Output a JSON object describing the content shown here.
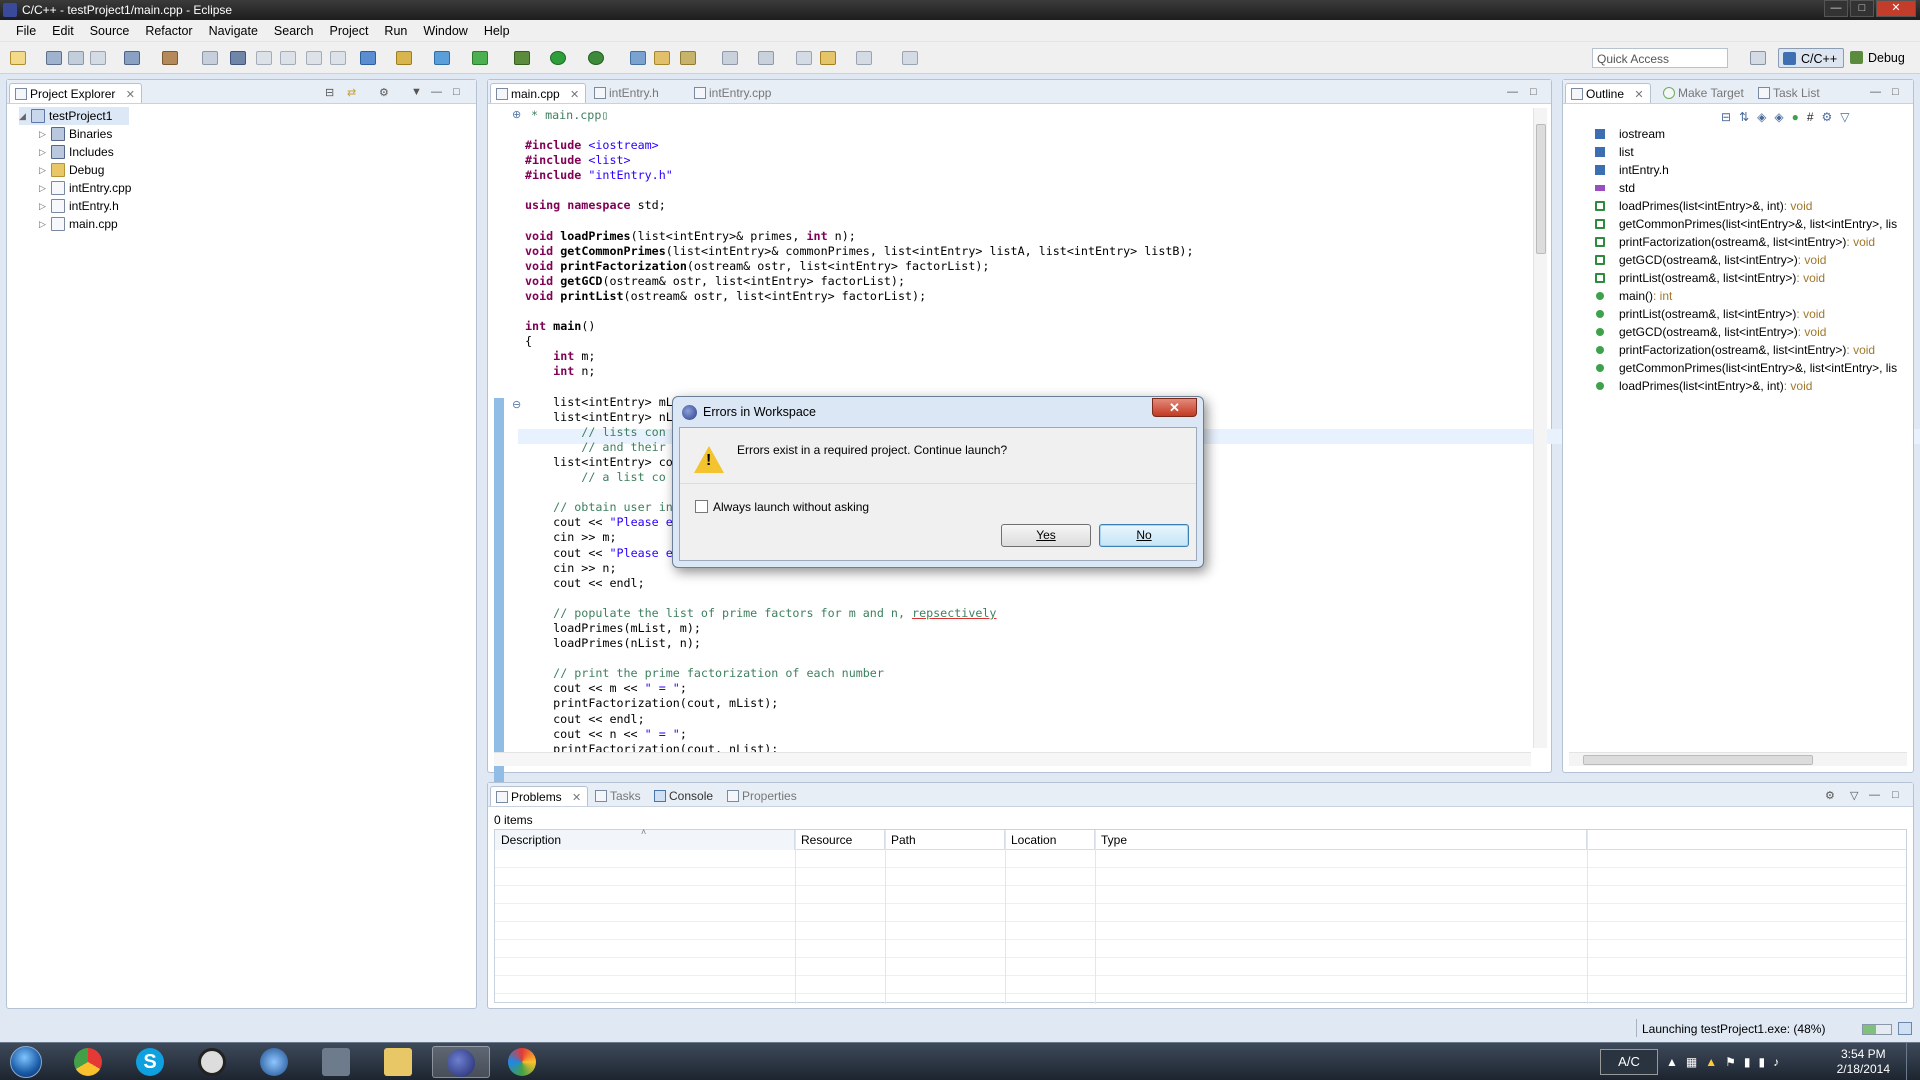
{
  "window": {
    "title": "C/C++ - testProject1/main.cpp - Eclipse"
  },
  "menu": [
    "File",
    "Edit",
    "Source",
    "Refactor",
    "Navigate",
    "Search",
    "Project",
    "Run",
    "Window",
    "Help"
  ],
  "toolbar": {
    "quick_access_placeholder": "Quick Access",
    "perspectives": [
      "C/C++",
      "Debug"
    ]
  },
  "project_explorer": {
    "title": "Project Explorer",
    "project": "testProject1",
    "items": [
      "Binaries",
      "Includes",
      "Debug",
      "intEntry.cpp",
      "intEntry.h",
      "main.cpp"
    ]
  },
  "editor": {
    "tabs": [
      "main.cpp",
      "intEntry.h",
      "intEntry.cpp"
    ],
    "header_comment": "* main.cpp"
  },
  "outline": {
    "tabs": [
      "Outline",
      "Make Target",
      "Task List"
    ],
    "items": [
      {
        "name": "iostream",
        "ret": "",
        "kind": "inc"
      },
      {
        "name": "list",
        "ret": "",
        "kind": "inc"
      },
      {
        "name": "intEntry.h",
        "ret": "",
        "kind": "inc"
      },
      {
        "name": "std",
        "ret": "",
        "kind": "ns"
      },
      {
        "name": "loadPrimes(list<intEntry>&, int)",
        "ret": " : void",
        "kind": "fn"
      },
      {
        "name": "getCommonPrimes(list<intEntry>&, list<intEntry>, lis",
        "ret": "",
        "kind": "fn"
      },
      {
        "name": "printFactorization(ostream&, list<intEntry>)",
        "ret": " : void",
        "kind": "fn"
      },
      {
        "name": "getGCD(ostream&, list<intEntry>)",
        "ret": " : void",
        "kind": "fn"
      },
      {
        "name": "printList(ostream&, list<intEntry>)",
        "ret": " : void",
        "kind": "fn"
      },
      {
        "name": "main()",
        "ret": " : int",
        "kind": "dot"
      },
      {
        "name": "printList(ostream&, list<intEntry>)",
        "ret": " : void",
        "kind": "dot"
      },
      {
        "name": "getGCD(ostream&, list<intEntry>)",
        "ret": " : void",
        "kind": "dot"
      },
      {
        "name": "printFactorization(ostream&, list<intEntry>)",
        "ret": " : void",
        "kind": "dot"
      },
      {
        "name": "getCommonPrimes(list<intEntry>&, list<intEntry>, lis",
        "ret": "",
        "kind": "dot"
      },
      {
        "name": "loadPrimes(list<intEntry>&, int)",
        "ret": " : void",
        "kind": "dot"
      }
    ]
  },
  "problems": {
    "tabs": [
      "Problems",
      "Tasks",
      "Console",
      "Properties"
    ],
    "count": "0 items",
    "columns": [
      "Description",
      "Resource",
      "Path",
      "Location",
      "Type"
    ]
  },
  "status": {
    "launch": "Launching testProject1.exe: (48%)",
    "progress": 0.48
  },
  "dialog": {
    "title": "Errors in Workspace",
    "message": "Errors exist in a required project. Continue launch?",
    "checkbox_label": "Always launch without asking",
    "yes": "Yes",
    "no": "No"
  },
  "taskbar": {
    "ac_label": "A/C",
    "time": "3:54 PM",
    "date": "2/18/2014"
  }
}
